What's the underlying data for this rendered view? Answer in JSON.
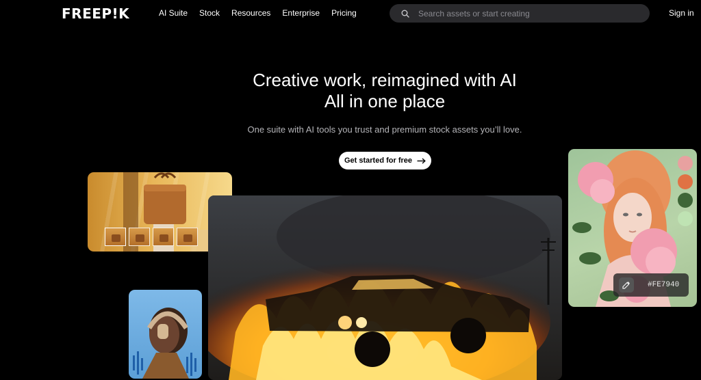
{
  "header": {
    "logo": "FREEP!K",
    "nav": [
      "AI Suite",
      "Stock",
      "Resources",
      "Enterprise",
      "Pricing"
    ],
    "search_placeholder": "Search assets or start creating",
    "sign_in": "Sign in"
  },
  "hero": {
    "title_line1": "Creative work, reimagined with AI",
    "title_line2": "All in one place",
    "subtitle": "One suite with AI tools you trust and premium stock assets you’ll love.",
    "cta_label": "Get started for free"
  },
  "portrait_card": {
    "palette": [
      "#E8A1A0",
      "#E07244",
      "#3E6637",
      "#BFE3B3"
    ],
    "hex_value": "#FE7940"
  },
  "icons": [
    "search-icon",
    "arrow-right-icon",
    "eyedropper-icon"
  ]
}
